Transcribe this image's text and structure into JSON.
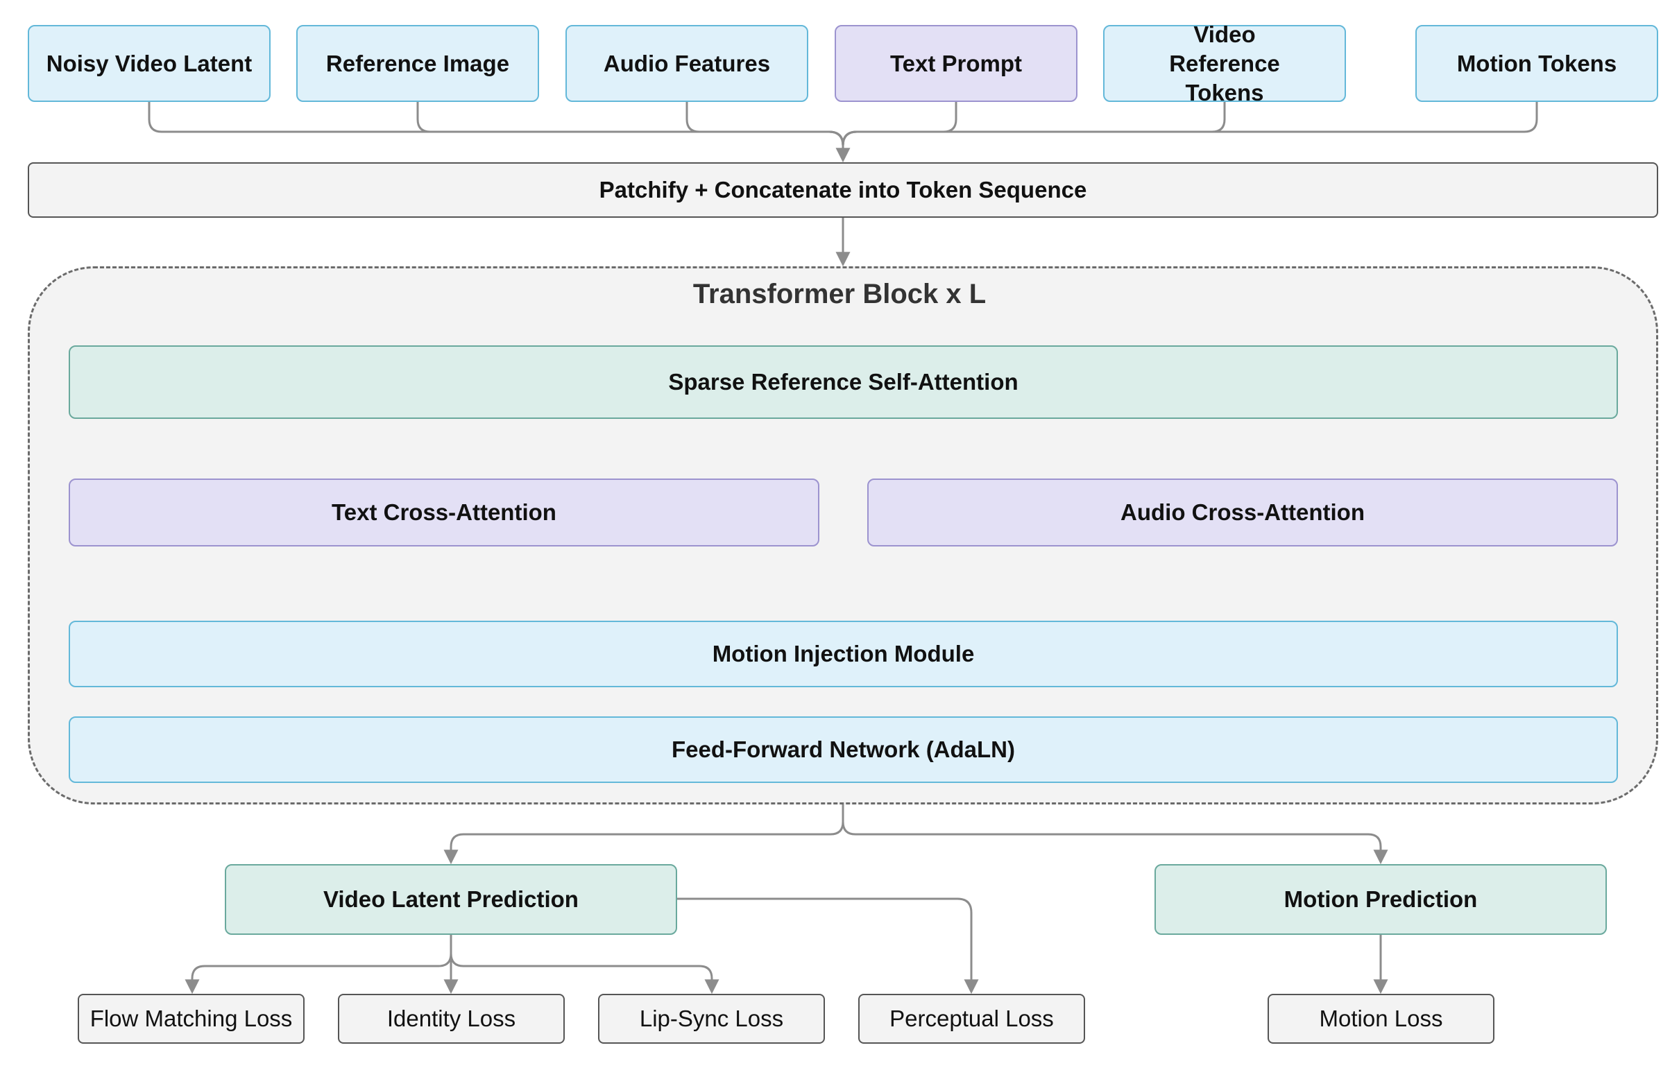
{
  "inputs": {
    "noisy_video_latent": "Noisy Video Latent",
    "reference_image": "Reference Image",
    "audio_features": "Audio Features",
    "text_prompt": "Text Prompt",
    "video_reference_tokens": "Video Reference Tokens",
    "motion_tokens": "Motion Tokens"
  },
  "patchify": "Patchify + Concatenate into Token Sequence",
  "transformer": {
    "title": "Transformer Block x L",
    "sparse_attention": "Sparse Reference Self-Attention",
    "text_cross_attention": "Text Cross-Attention",
    "audio_cross_attention": "Audio Cross-Attention",
    "motion_injection": "Motion Injection Module",
    "ffn": "Feed-Forward Network (AdaLN)"
  },
  "outputs": {
    "video_latent_prediction": "Video Latent Prediction",
    "motion_prediction": "Motion Prediction"
  },
  "losses": {
    "flow_matching": "Flow Matching Loss",
    "identity": "Identity Loss",
    "lip_sync": "Lip-Sync Loss",
    "perceptual": "Perceptual Loss",
    "motion": "Motion Loss"
  },
  "colors": {
    "input_fill": "#dff1fa",
    "input_border": "#63b8d9",
    "text_fill": "#e3e0f5",
    "text_border": "#9c93cf",
    "teal_fill": "#dceeea",
    "teal_border": "#6aa99d",
    "neutral_fill": "#f3f3f3",
    "connector": "#8c8c8c"
  }
}
